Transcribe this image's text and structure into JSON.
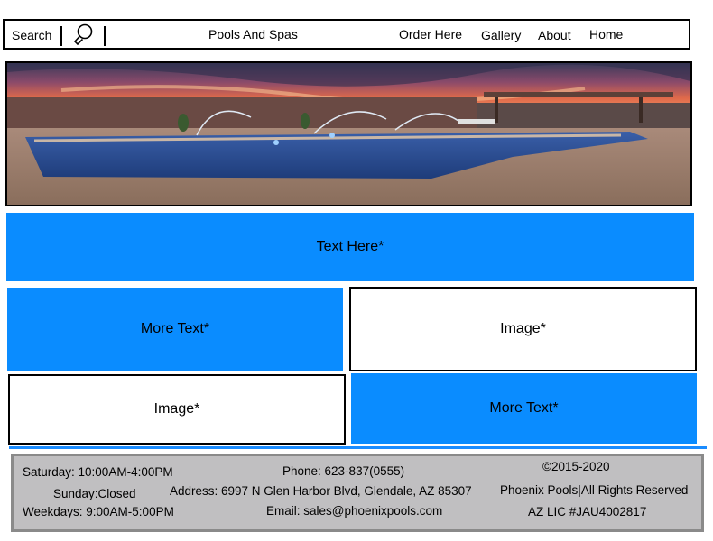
{
  "nav": {
    "search_label": "Search",
    "search_icon": "magnifier-icon",
    "title": "Pools And Spas",
    "links": [
      "Order Here",
      "Gallery",
      "About",
      "Home"
    ]
  },
  "hero": {
    "image_description_icon": "pool-photo"
  },
  "content": {
    "text_here": "Text Here*",
    "more_text_1": "More Text*",
    "image_1": "Image*",
    "image_2": "Image*",
    "more_text_2": "More Text*"
  },
  "footer": {
    "saturday": "Saturday: 10:00AM-4:00PM",
    "sunday": "Sunday:Closed",
    "weekdays": "Weekdays: 9:00AM-5:00PM",
    "phone": "Phone: 623-837(0555)",
    "address": "Address: 6997 N Glen Harbor Blvd, Glendale, AZ 85307",
    "email": "Email: sales@phoenixpools.com",
    "copyright": "©2015-2020",
    "rights": "Phoenix Pools|All Rights Reserved",
    "license": "AZ LIC #JAU4002817"
  },
  "colors": {
    "accent_blue": "#0a8cff",
    "footer_bg": "#c0bfc1",
    "separator": "#1a8cff"
  }
}
